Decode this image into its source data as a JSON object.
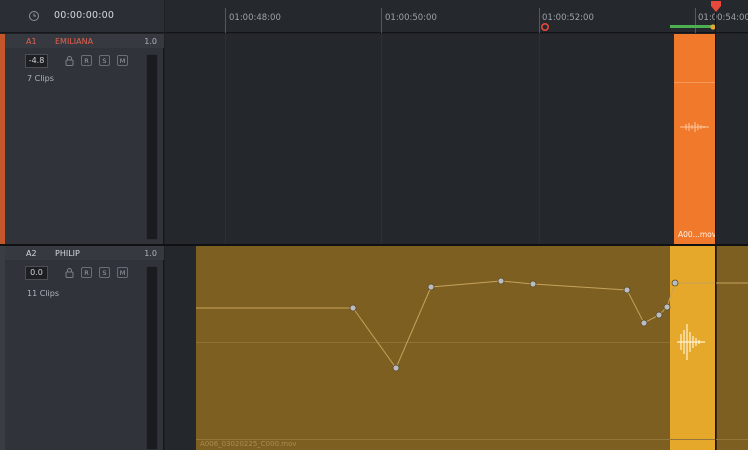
{
  "timecode": "00:00:00:00",
  "ruler": {
    "ticks": [
      "01:00:48:00",
      "01:00:50:00",
      "01:00:52:00",
      "01:00:54:00"
    ]
  },
  "tracks": [
    {
      "id": "A1",
      "name": "EMILIANA",
      "level": "1.0",
      "volume": "-4.8",
      "buttons": [
        "R",
        "S",
        "M"
      ],
      "clips_count": "7 Clips",
      "clip_label": "A00...mov",
      "color": "#f0792c"
    },
    {
      "id": "A2",
      "name": "PHILIP",
      "level": "1.0",
      "volume": "0.0",
      "buttons": [
        "R",
        "S",
        "M"
      ],
      "clips_count": "11 Clips",
      "clip_label": "A006_03020225_C000.mov",
      "color": "#7d5f22"
    }
  ],
  "colors": {
    "playhead": "#e8473c",
    "a1_clip": "#f0792c",
    "a2_clip": "#7d5f22",
    "a2_highlight": "#e5a82a",
    "keyframe_line": "#c6a25a"
  },
  "icons": {
    "clock": "clock-icon",
    "lock": "lock-icon",
    "marker": "marker-icon"
  }
}
